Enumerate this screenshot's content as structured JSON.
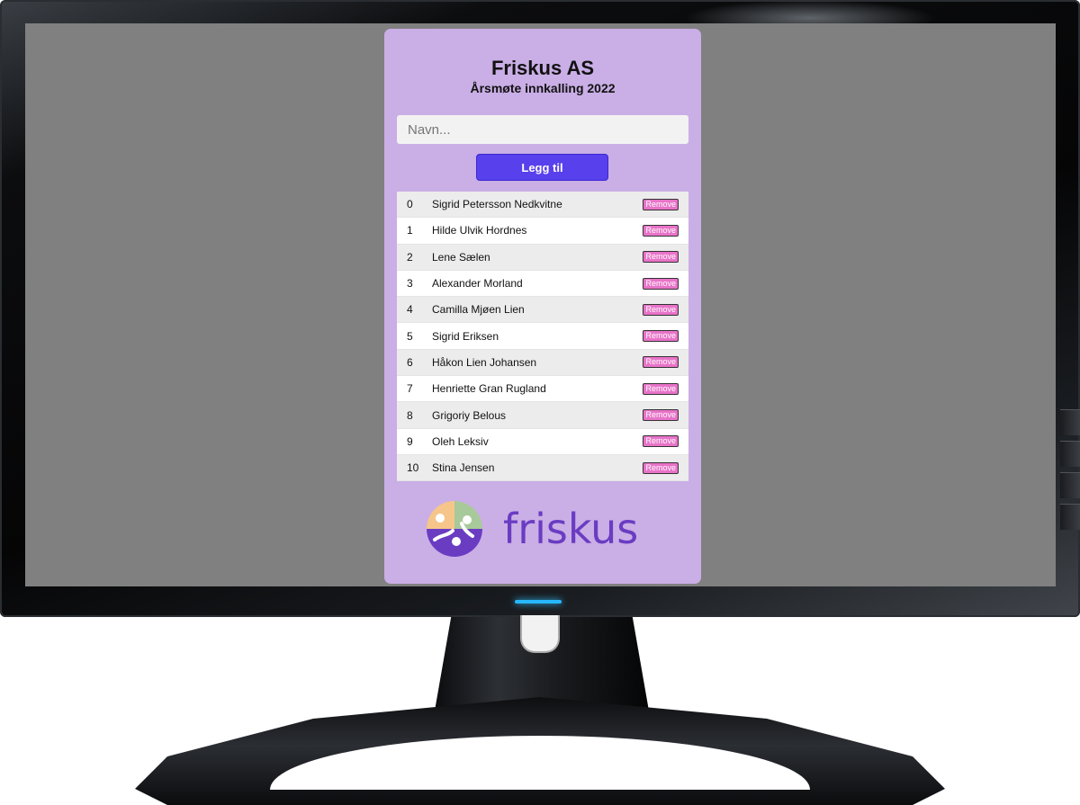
{
  "app": {
    "title": "Friskus AS",
    "subtitle": "Årsmøte innkalling 2022"
  },
  "form": {
    "name_placeholder": "Navn...",
    "add_label": "Legg til"
  },
  "attendees": [
    {
      "index": "0",
      "name": "Sigrid Petersson Nedkvitne",
      "action": "Remove"
    },
    {
      "index": "1",
      "name": "Hilde Ulvik Hordnes",
      "action": "Remove"
    },
    {
      "index": "2",
      "name": "Lene Sælen",
      "action": "Remove"
    },
    {
      "index": "3",
      "name": "Alexander Morland",
      "action": "Remove"
    },
    {
      "index": "4",
      "name": "Camilla Mjøen Lien",
      "action": "Remove"
    },
    {
      "index": "5",
      "name": "Sigrid Eriksen",
      "action": "Remove"
    },
    {
      "index": "6",
      "name": "Håkon Lien Johansen",
      "action": "Remove"
    },
    {
      "index": "7",
      "name": "Henriette Gran Rugland",
      "action": "Remove"
    },
    {
      "index": "8",
      "name": "Grigoriy Belous",
      "action": "Remove"
    },
    {
      "index": "9",
      "name": "Oleh Leksiv",
      "action": "Remove"
    },
    {
      "index": "10",
      "name": "Stina Jensen",
      "action": "Remove"
    }
  ],
  "logo": {
    "wordmark": "friskus",
    "icon": "friskus-logo-icon"
  },
  "colors": {
    "screen_background": "#808080",
    "card_background": "#caaee6",
    "add_button": "#5840ec",
    "remove_button": "#e873c8",
    "logo_purple": "#6a3cc2",
    "logo_green": "#a8c99a",
    "logo_orange": "#f6c58a",
    "power_led": "#27b8ff"
  }
}
